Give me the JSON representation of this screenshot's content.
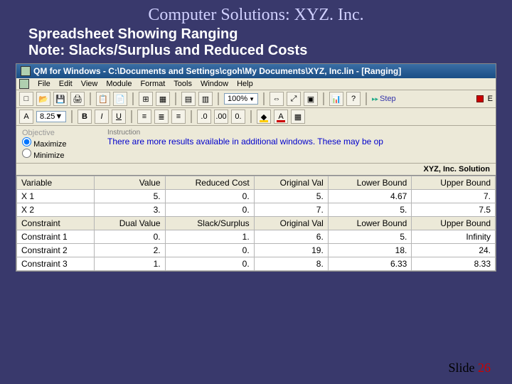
{
  "slide": {
    "title": "Computer Solutions: XYZ. Inc.",
    "sub1": "Spreadsheet Showing Ranging",
    "sub2": "Note: Slacks/Surplus and Reduced Costs",
    "footer_label": "Slide",
    "footer_num": "26"
  },
  "app": {
    "title": "QM for Windows - C:\\Documents and Settings\\cgoh\\My Documents\\XYZ, Inc.lin - [Ranging]",
    "menus": [
      "File",
      "Edit",
      "View",
      "Module",
      "Format",
      "Tools",
      "Window",
      "Help"
    ],
    "zoom": "100%",
    "fontsize": "8.25",
    "step_label": "Step",
    "obj_group": "Objective",
    "obj_max": "Maximize",
    "obj_min": "Minimize",
    "instr_label": "Instruction",
    "instr_text": "There are more results available in additional windows. These may be op",
    "sol_header": "XYZ, Inc. Solution",
    "hdr_var": [
      "Variable",
      "Value",
      "Reduced Cost",
      "Original Val",
      "Lower Bound",
      "Upper Bound"
    ],
    "rows_var": [
      {
        "n": "X 1",
        "v": "5.",
        "rc": "0.",
        "ov": "5.",
        "lb": "4.67",
        "ub": "7."
      },
      {
        "n": "X 2",
        "v": "3.",
        "rc": "0.",
        "ov": "7.",
        "lb": "5.",
        "ub": "7.5"
      }
    ],
    "hdr_con": [
      "Constraint",
      "Dual Value",
      "Slack/Surplus",
      "Original Val",
      "Lower Bound",
      "Upper Bound"
    ],
    "rows_con": [
      {
        "n": "Constraint 1",
        "dv": "0.",
        "ss": "1.",
        "ov": "6.",
        "lb": "5.",
        "ub": "Infinity"
      },
      {
        "n": "Constraint 2",
        "dv": "2.",
        "ss": "0.",
        "ov": "19.",
        "lb": "18.",
        "ub": "24."
      },
      {
        "n": "Constraint 3",
        "dv": "1.",
        "ss": "0.",
        "ov": "8.",
        "lb": "6.33",
        "ub": "8.33"
      }
    ]
  }
}
